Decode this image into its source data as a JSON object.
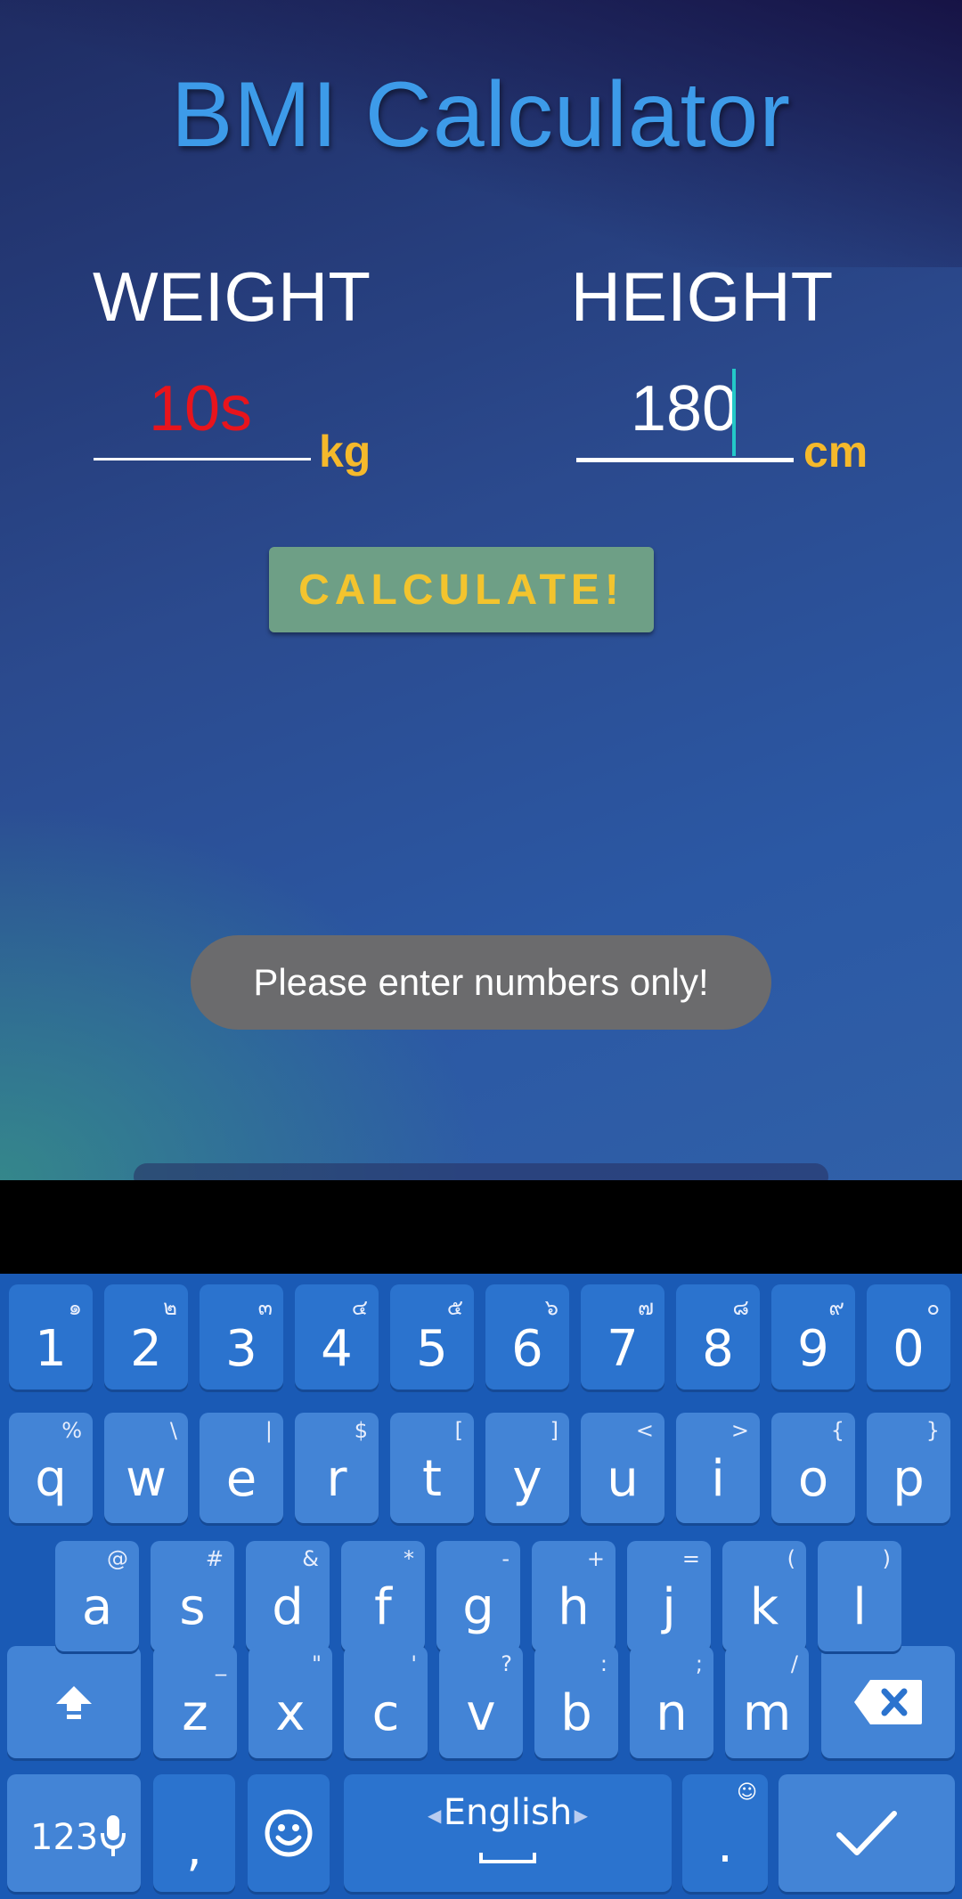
{
  "app": {
    "title": "BMI Calculator",
    "weight_label": "WEIGHT",
    "weight_value": "10s",
    "weight_unit": "kg",
    "height_label": "HEIGHT",
    "height_value": "180",
    "height_unit": "cm",
    "calculate_label": "CALCULATE!",
    "colors": {
      "title": "#3d9be9",
      "weight_value": "#e8141c",
      "unit": "#f5b92b",
      "button": "#6e9f86"
    }
  },
  "toast": {
    "message": "Please enter numbers only!"
  },
  "keyboard": {
    "number_row": [
      {
        "main": "1",
        "hint": "๑"
      },
      {
        "main": "2",
        "hint": "๒"
      },
      {
        "main": "3",
        "hint": "๓"
      },
      {
        "main": "4",
        "hint": "๔"
      },
      {
        "main": "5",
        "hint": "๕"
      },
      {
        "main": "6",
        "hint": "๖"
      },
      {
        "main": "7",
        "hint": "๗"
      },
      {
        "main": "8",
        "hint": "๘"
      },
      {
        "main": "9",
        "hint": "๙"
      },
      {
        "main": "0",
        "hint": "๐"
      }
    ],
    "row1": [
      {
        "main": "q",
        "hint": "%"
      },
      {
        "main": "w",
        "hint": "\\"
      },
      {
        "main": "e",
        "hint": "|"
      },
      {
        "main": "r",
        "hint": "$"
      },
      {
        "main": "t",
        "hint": "["
      },
      {
        "main": "y",
        "hint": "]"
      },
      {
        "main": "u",
        "hint": "<"
      },
      {
        "main": "i",
        "hint": ">"
      },
      {
        "main": "o",
        "hint": "{"
      },
      {
        "main": "p",
        "hint": "}"
      }
    ],
    "row2": [
      {
        "main": "a",
        "hint": "@"
      },
      {
        "main": "s",
        "hint": "#"
      },
      {
        "main": "d",
        "hint": "&"
      },
      {
        "main": "f",
        "hint": "*"
      },
      {
        "main": "g",
        "hint": "-"
      },
      {
        "main": "h",
        "hint": "+"
      },
      {
        "main": "j",
        "hint": "="
      },
      {
        "main": "k",
        "hint": "("
      },
      {
        "main": "l",
        "hint": ")"
      }
    ],
    "row3": [
      {
        "main": "z",
        "hint": "_"
      },
      {
        "main": "x",
        "hint": "\""
      },
      {
        "main": "c",
        "hint": "'"
      },
      {
        "main": "v",
        "hint": "?"
      },
      {
        "main": "b",
        "hint": ":"
      },
      {
        "main": "n",
        "hint": ";"
      },
      {
        "main": "m",
        "hint": "/"
      }
    ],
    "symbols_label": "123",
    "comma_label": ",",
    "space_label": "English",
    "period_label": ".",
    "icons": {
      "shift": "shift-icon",
      "backspace": "backspace-icon",
      "mic": "mic-icon",
      "emoji": "emoji-icon",
      "enter": "checkmark-icon"
    }
  }
}
